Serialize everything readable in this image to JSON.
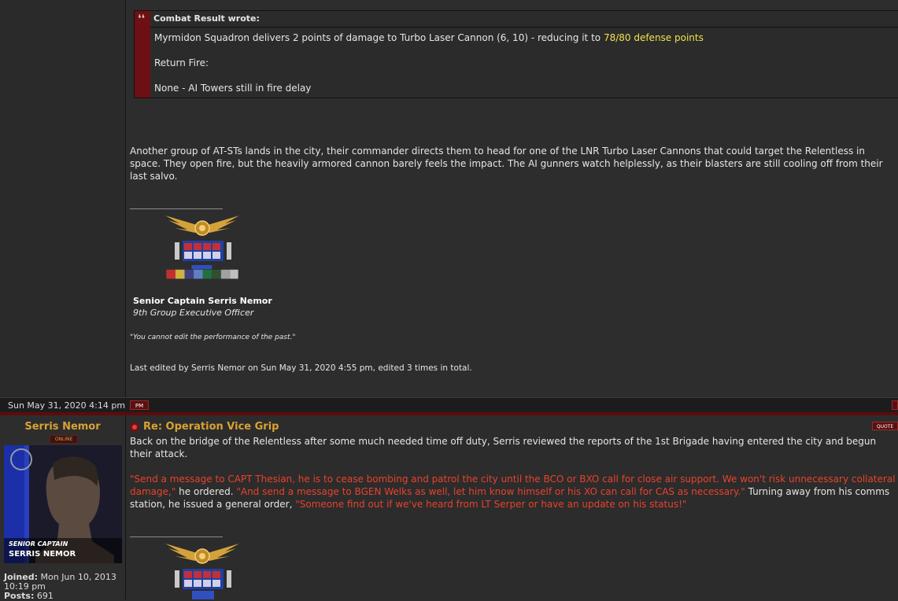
{
  "quote": {
    "author": "Combat Result wrote:",
    "line1_pre": "Myrmidon Squadron delivers 2 points of damage to Turbo Laser Cannon (6, 10) - reducing it to ",
    "line1_highlight": "78/80 defense points",
    "line2": "Return Fire:",
    "line3": "None - AI Towers still in fire delay"
  },
  "post1": {
    "body": "Another group of AT-STs lands in the city, their commander directs them to head for one of the LNR Turbo Laser Cannons that could target the Relentless in space. They open fire, but the heavily armored cannon barely feels the impact. The AI gunners watch helplessly, as their blasters are still cooling off from their last salvo.",
    "signature": {
      "name": "Senior Captain Serris Nemor",
      "title": "9th Group Executive Officer",
      "quote": "\"You cannot edit the performance of the past.\""
    },
    "edit_note": "Last edited by Serris Nemor on Sun May 31, 2020 4:55 pm, edited 3 times in total.",
    "date": "Sun May 31, 2020 4:14 pm",
    "pm_label": "PM"
  },
  "post2": {
    "author": "Serris Nemor",
    "online_label": "ONLINE",
    "avatar_rank": "SENIOR CAPTAIN",
    "avatar_name": "SERRIS NEMOR",
    "joined_label": "Joined:",
    "joined_value": "Mon Jun 10, 2013 10:19 pm",
    "posts_label": "Posts:",
    "posts_value": "691",
    "title": "Re: Operation Vice Grip",
    "quote_label": "QUOTE",
    "para1": "Back on the bridge of the Relentless after some much needed time off duty, Serris reviewed the reports of the 1st Brigade having entered the city and begun their attack.",
    "para2_red1": "\"Send a message to CAPT Thesian, he is to cease bombing and patrol the city until the BCO or BXO call for close air support. We won't risk unnecessary collateral damage,\"",
    "para2_t1": " he ordered. ",
    "para2_red2": "\"And send a message to BGEN Welks as well, let him know himself or his XO can call for CAS as necessary.\"",
    "para2_t2": " Turning away from his comms station, he issued a general order, ",
    "para2_red3": "\"Someone find out if we've heard from LT Serper or have an update on his status!\""
  },
  "colors": {
    "accent_gold": "#d9a233",
    "highlight_yellow": "#f3e14a",
    "speech_red": "#e8422b",
    "quote_bar": "#6d0f13"
  }
}
